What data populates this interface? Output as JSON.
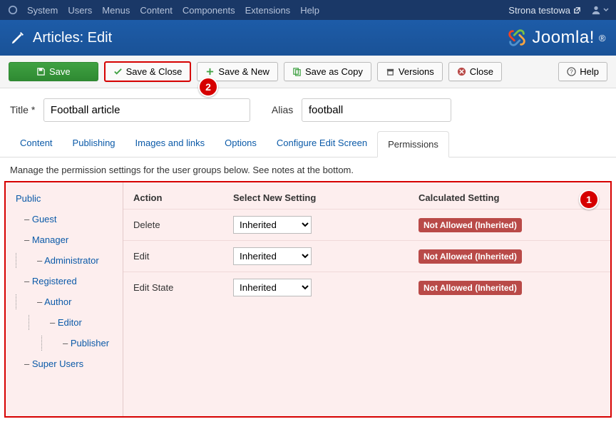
{
  "menubar": {
    "items": [
      "System",
      "Users",
      "Menus",
      "Content",
      "Components",
      "Extensions",
      "Help"
    ],
    "site": "Strona testowa"
  },
  "header": {
    "title": "Articles: Edit",
    "brand": "Joomla!"
  },
  "toolbar": {
    "save": "Save",
    "save_close": "Save & Close",
    "save_new": "Save & New",
    "save_copy": "Save as Copy",
    "versions": "Versions",
    "close": "Close",
    "help": "Help"
  },
  "badges": {
    "one": "1",
    "two": "2"
  },
  "fields": {
    "title_label": "Title *",
    "title_value": "Football article",
    "alias_label": "Alias",
    "alias_value": "football"
  },
  "tabs": [
    "Content",
    "Publishing",
    "Images and links",
    "Options",
    "Configure Edit Screen",
    "Permissions"
  ],
  "desc": "Manage the permission settings for the user groups below. See notes at the bottom.",
  "perm": {
    "groups": [
      "Public",
      "Guest",
      "Manager",
      "Administrator",
      "Registered",
      "Author",
      "Editor",
      "Publisher",
      "Super Users"
    ],
    "head": {
      "action": "Action",
      "select": "Select New Setting",
      "calc": "Calculated Setting"
    },
    "rows": [
      {
        "action": "Delete",
        "setting": "Inherited",
        "calc": "Not Allowed (Inherited)"
      },
      {
        "action": "Edit",
        "setting": "Inherited",
        "calc": "Not Allowed (Inherited)"
      },
      {
        "action": "Edit State",
        "setting": "Inherited",
        "calc": "Not Allowed (Inherited)"
      }
    ]
  }
}
